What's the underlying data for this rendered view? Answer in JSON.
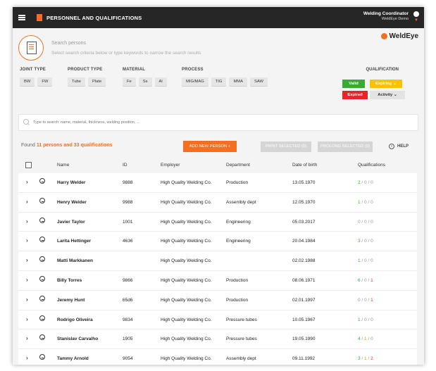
{
  "header": {
    "title": "PERSONNEL AND QUALIFICATIONS",
    "user_role": "Welding Coordinator",
    "user_org": "WeldEye Demo"
  },
  "search_head": {
    "title": "Search persons",
    "subtitle": "Select search criteria below or type keywords to narrow the search results",
    "brand": "WeldEye"
  },
  "filters": {
    "joint_type": {
      "label": "JOINT TYPE",
      "chips": [
        "BW",
        "FW"
      ]
    },
    "product_type": {
      "label": "PRODUCT TYPE",
      "chips": [
        "Tube",
        "Plate"
      ]
    },
    "material": {
      "label": "MATERIAL",
      "chips": [
        "Fe",
        "Ss",
        "Al"
      ]
    },
    "process": {
      "label": "PROCESS",
      "chips": [
        "MIG/MAG",
        "TIG",
        "MMA",
        "SAW"
      ]
    },
    "qualification": {
      "label": "QUALIFICATION",
      "valid": "Valid",
      "expiring": "Expiring",
      "expired": "Expired",
      "activity": "Activity"
    }
  },
  "search": {
    "placeholder": "Type to search: name, material, thickness, welding position, ..."
  },
  "results": {
    "found_prefix": "Found",
    "found_highlight": "11 persons and 33 qualifications",
    "add_new": "ADD NEW PERSON +",
    "print_selected": "PRINT SELECTED (0)",
    "prolong_selected": "PROLONG SELECTED (0)",
    "help": "HELP"
  },
  "table": {
    "columns": [
      "Name",
      "ID",
      "Employer",
      "Department",
      "Date of birth",
      "Qualifications"
    ],
    "rows": [
      {
        "name": "Harry Welder",
        "id": "9888",
        "employer": "High Quality Welding Co.",
        "department": "Production",
        "dob": "13.05.1970",
        "q": [
          "2",
          "0",
          "0"
        ]
      },
      {
        "name": "Henry Welder",
        "id": "9988",
        "employer": "High Quality Welding Co.",
        "department": "Assembly dept",
        "dob": "12.05.1970",
        "q": [
          "1",
          "0",
          "0"
        ]
      },
      {
        "name": "Javier Taylor",
        "id": "1001",
        "employer": "High Quality Welding Co.",
        "department": "Engineering",
        "dob": "05.03.2017",
        "q": [
          "0",
          "0",
          "0"
        ]
      },
      {
        "name": "Larita Hettinger",
        "id": "4636",
        "employer": "High Quality Welding Co.",
        "department": "Engineering",
        "dob": "20.04.1984",
        "q": [
          "3",
          "0",
          "0"
        ]
      },
      {
        "name": "Matti Markkanen",
        "id": "",
        "employer": "High Quality Welding Co.",
        "department": "",
        "dob": "02.02.1988",
        "q": [
          "1",
          "0",
          "0"
        ]
      },
      {
        "name": "Billy Torres",
        "id": "9866",
        "employer": "High Quality Welding Co.",
        "department": "Production",
        "dob": "08.06.1971",
        "q": [
          "6",
          "0",
          "1"
        ]
      },
      {
        "name": "Jeremy Hunt",
        "id": "65d6",
        "employer": "High Quality Welding Co.",
        "department": "Production",
        "dob": "02.01.1997",
        "q": [
          "0",
          "0",
          "1"
        ]
      },
      {
        "name": "Rodrigo Oliveira",
        "id": "9834",
        "employer": "High Quality Welding Co.",
        "department": "Pressure tubes",
        "dob": "10.05.1967",
        "q": [
          "1",
          "0",
          "0"
        ]
      },
      {
        "name": "Stanislav Carvalho",
        "id": "1905",
        "employer": "High Quality Welding Co.",
        "department": "Pressure tubes",
        "dob": "19.05.1990",
        "q": [
          "4",
          "1",
          "0"
        ]
      },
      {
        "name": "Tammy Arnold",
        "id": "9054",
        "employer": "High Quality Welding Co.",
        "department": "Assembly dept",
        "dob": "09.11.1992",
        "q": [
          "3",
          "1",
          "2"
        ]
      }
    ]
  }
}
